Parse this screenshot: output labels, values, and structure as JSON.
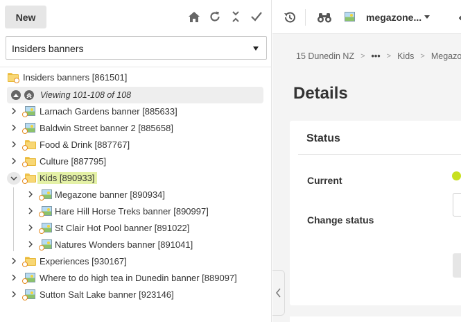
{
  "left_panel": {
    "new_button": "New",
    "toolbar_icons": [
      "home-icon",
      "refresh-icon",
      "collapse-all-icon",
      "checkmark-icon"
    ],
    "dropdown_value": "Insiders banners",
    "tree": {
      "root": "Insiders banners [861501]",
      "paging": "Viewing 101-108 of 108",
      "items": [
        {
          "label": "Larnach Gardens banner [885633]",
          "icon": "image-icon"
        },
        {
          "label": "Baldwin Street banner 2 [885658]",
          "icon": "image-icon"
        },
        {
          "label": "Food & Drink [887767]",
          "icon": "folder-icon"
        },
        {
          "label": "Culture [887795]",
          "icon": "folder-icon"
        },
        {
          "label": "Kids [890933]",
          "icon": "folder-icon",
          "expanded": true,
          "highlighted": true
        },
        {
          "label": "Megazone banner [890934]",
          "icon": "image-icon",
          "child": true
        },
        {
          "label": "Hare Hill Horse Treks banner [890997]",
          "icon": "image-icon",
          "child": true
        },
        {
          "label": "St Clair Hot Pool banner [891022]",
          "icon": "image-icon",
          "child": true
        },
        {
          "label": "Natures Wonders banner [891041]",
          "icon": "image-icon",
          "child": true
        },
        {
          "label": "Experiences [930167]",
          "icon": "folder-icon"
        },
        {
          "label": "Where to do high tea in Dunedin banner [889097]",
          "icon": "image-icon"
        },
        {
          "label": "Sutton Salt Lake banner [923146]",
          "icon": "image-icon"
        }
      ]
    }
  },
  "right_panel": {
    "toolbar": {
      "history_icon": "history-icon",
      "binoculars_icon": "binoculars-icon",
      "item_label": "megazone...",
      "item_icon": "image-icon"
    },
    "breadcrumb": {
      "first": "15 Dunedin NZ",
      "ellipsis": "•••",
      "second": "Kids",
      "third": "Megazon"
    },
    "heading": "Details",
    "status_card": {
      "title": "Status",
      "current_label": "Current",
      "change_status_label": "Change status",
      "status_color": "#c8e01e"
    }
  },
  "colors": {
    "folder": "#f8d775",
    "kids_highlight": "#e4f1a6",
    "badge": "#e48a1e"
  }
}
